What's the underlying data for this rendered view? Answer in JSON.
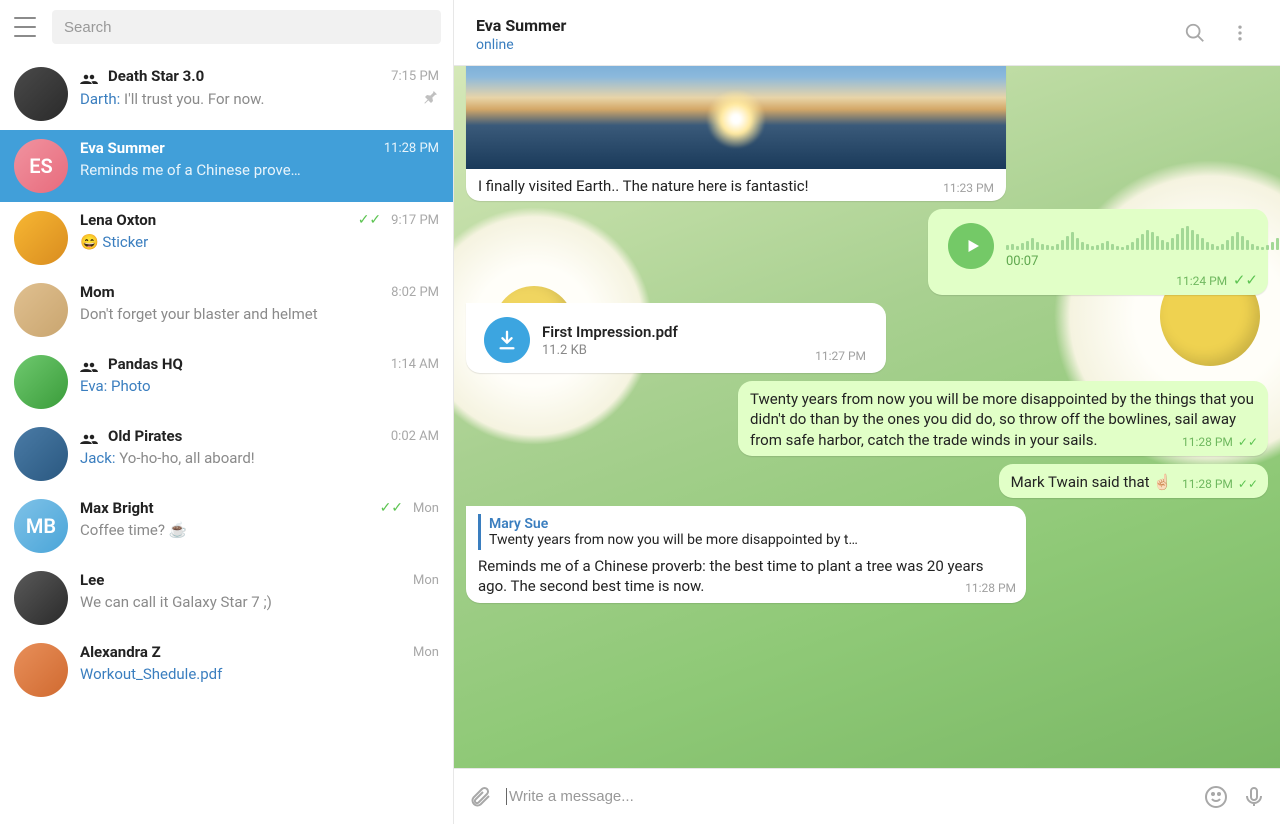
{
  "sidebar": {
    "search_placeholder": "Search",
    "chats": [
      {
        "name": "Death Star 3.0",
        "time": "7:15 PM",
        "sender": "Darth:",
        "preview": " I'll trust you. For now.",
        "group": true,
        "avatar": "ds",
        "pinned": true
      },
      {
        "name": "Eva Summer",
        "time": "11:28 PM",
        "preview": "Reminds me of a Chinese prove…",
        "avatar": "es",
        "initials": "ES",
        "active": true
      },
      {
        "name": "Lena Oxton",
        "time": "9:17 PM",
        "preview_emoji": "😄 ",
        "preview_link": "Sticker",
        "read": true,
        "avatar": "lo"
      },
      {
        "name": "Mom",
        "time": "8:02 PM",
        "preview": "Don't forget your blaster and helmet",
        "avatar": "mom"
      },
      {
        "name": "Pandas HQ",
        "time": "1:14 AM",
        "sender": "Eva:",
        "preview_link": " Photo",
        "group": true,
        "avatar": "phq"
      },
      {
        "name": "Old Pirates",
        "time": "0:02 AM",
        "sender": "Jack:",
        "preview": " Yo-ho-ho, all aboard!",
        "group": true,
        "avatar": "op"
      },
      {
        "name": "Max Bright",
        "time": "Mon",
        "preview": "Coffee time? ☕",
        "read": true,
        "avatar": "mb",
        "initials": "MB"
      },
      {
        "name": "Lee",
        "time": "Mon",
        "preview": "We can call it Galaxy Star 7 ;)",
        "avatar": "lee"
      },
      {
        "name": "Alexandra Z",
        "time": "Mon",
        "preview_link": "Workout_Shedule.pdf",
        "avatar": "az"
      }
    ]
  },
  "header": {
    "name": "Eva Summer",
    "status": "online"
  },
  "messages": {
    "photo_caption": "I finally visited Earth.. The nature here is fantastic!",
    "photo_time": "11:23 PM",
    "voice_duration": "00:07",
    "voice_time": "11:24 PM",
    "file_name": "First Impression.pdf",
    "file_size": "11.2 KB",
    "file_time": "11:27 PM",
    "quote_text": "Twenty years from now you will be more disappointed by the things that you didn't do than by the ones you did do, so throw off the bowlines, sail away from safe harbor, catch the trade winds in your sails.",
    "quote_time": "11:28 PM",
    "twain_text": "Mark Twain said that ☝🏻",
    "twain_time": "11:28 PM",
    "reply_name": "Mary Sue",
    "reply_preview": "Twenty years from now you will be more disappointed by t…",
    "reply_body": "Reminds me of a Chinese proverb: the best time to plant a tree was 20 years ago. The second best time is now.",
    "reply_time": "11:28 PM"
  },
  "compose": {
    "placeholder": "Write a message..."
  }
}
